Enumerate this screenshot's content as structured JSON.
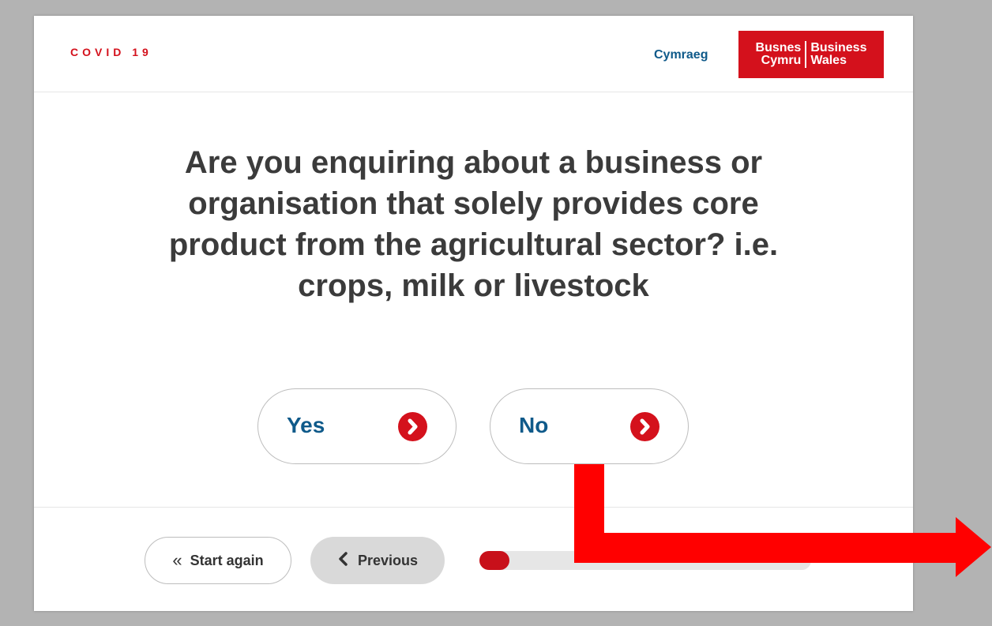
{
  "header": {
    "label": "COVID 19",
    "language_link": "Cymraeg",
    "logo": {
      "left_line1": "Busnes",
      "left_line2": "Cymru",
      "right_line1": "Business",
      "right_line2": "Wales"
    }
  },
  "question": {
    "text": "Are you enquiring about a business or organisation that solely provides core product from the agricultural sector? i.e. crops, milk or livestock"
  },
  "answers": [
    {
      "label": "Yes",
      "icon": "chevron-right-circle-icon"
    },
    {
      "label": "No",
      "icon": "chevron-right-circle-icon"
    }
  ],
  "footer": {
    "start_again_label": "Start again",
    "start_again_icon": "double-chevron-left-icon",
    "previous_label": "Previous",
    "previous_icon": "chevron-left-icon",
    "progress": 0.09
  },
  "colors": {
    "brand_red": "#d4111c",
    "link_blue": "#0f5a8a",
    "annotation_red": "#ff0000"
  }
}
